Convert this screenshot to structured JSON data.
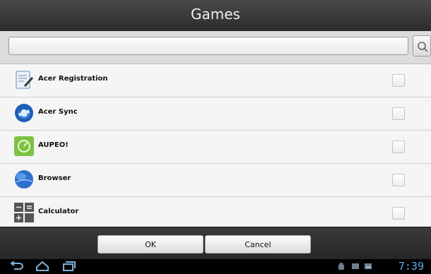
{
  "window": {
    "title": "Games"
  },
  "search": {
    "value": "",
    "placeholder": "",
    "icon": "search-icon"
  },
  "apps": [
    {
      "label": "Acer Registration",
      "icon": "registration-icon",
      "checked": false
    },
    {
      "label": "Acer Sync",
      "icon": "sync-icon",
      "checked": false
    },
    {
      "label": "AUPEO!",
      "icon": "aupeo-icon",
      "checked": false
    },
    {
      "label": "Browser",
      "icon": "globe-icon",
      "checked": false
    },
    {
      "label": "Calculator",
      "icon": "calculator-icon",
      "checked": false
    }
  ],
  "actions": {
    "ok_label": "OK",
    "cancel_label": "Cancel"
  },
  "system_bar": {
    "time": "7:39",
    "nav_icons": [
      "back-icon",
      "home-icon",
      "recent-apps-icon"
    ],
    "accent_color": "#5aa9e6"
  }
}
